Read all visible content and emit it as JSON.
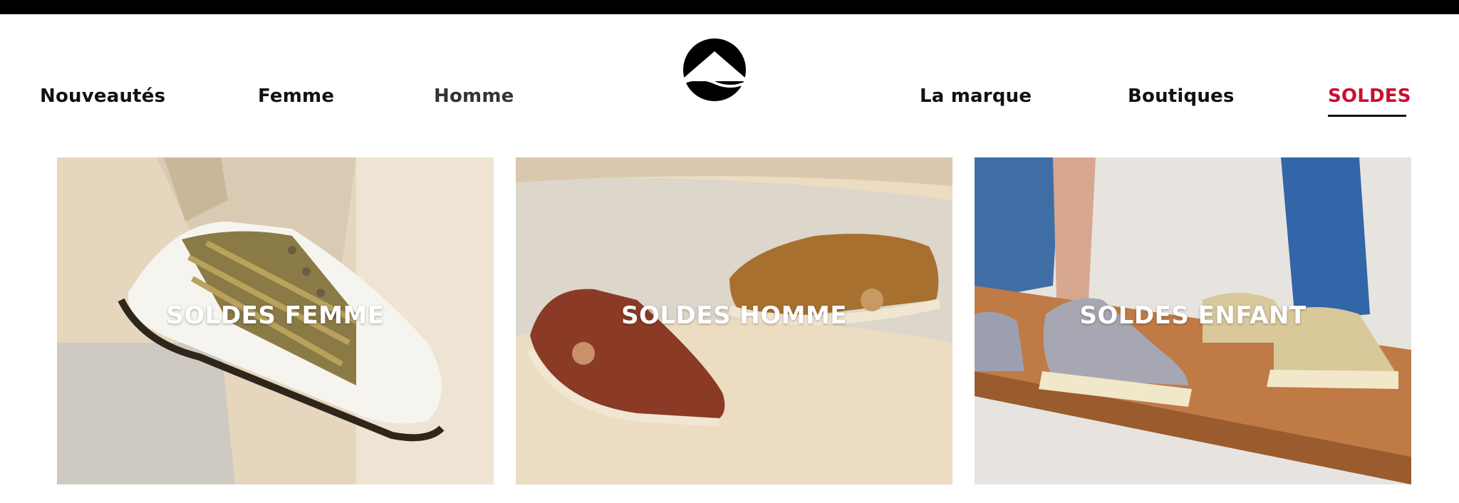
{
  "nav": {
    "left": [
      "Nouveautés",
      "Femme",
      "Homme"
    ],
    "right": [
      "La marque",
      "Boutiques",
      "SOLDES"
    ]
  },
  "logo": {
    "icon": "mountain-wave-icon"
  },
  "colors": {
    "accent": "#c8102e",
    "text": "#111111",
    "background": "#ffffff",
    "topbar": "#000000"
  },
  "cards": [
    {
      "title": "SOLDES FEMME",
      "image": "white-woven-sneaker-photo"
    },
    {
      "title": "SOLDES HOMME",
      "image": "suede-sneakers-pair-photo"
    },
    {
      "title": "SOLDES ENFANT",
      "image": "kids-boots-on-bench-photo"
    }
  ]
}
